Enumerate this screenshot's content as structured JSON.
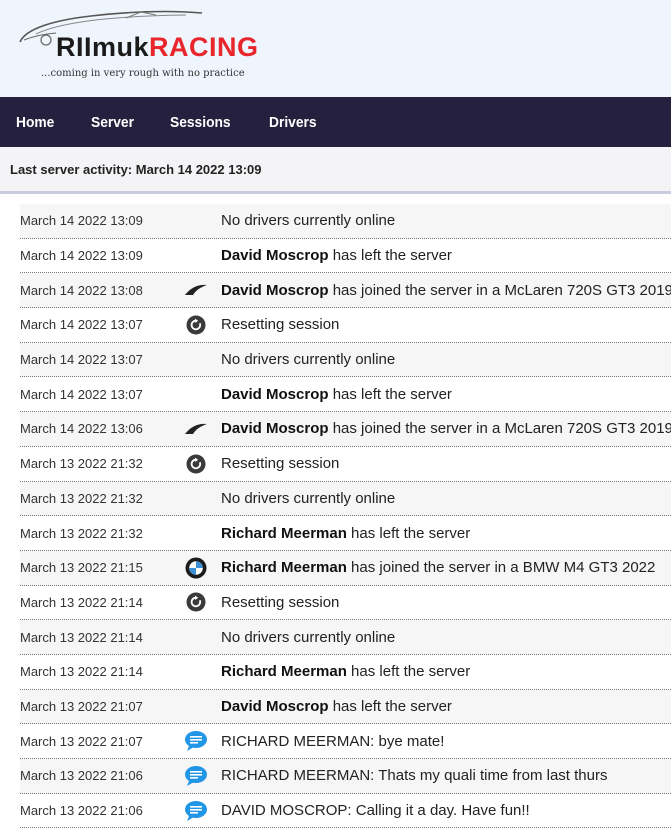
{
  "brand": {
    "part1": "RIImuk",
    "part2": "RACING",
    "tagline": "...coming in very rough with no practice"
  },
  "nav": [
    "Home",
    "Server",
    "Sessions",
    "Drivers"
  ],
  "activity": "Last server activity: March 14 2022 13:09",
  "colors": {
    "nav_bg": "#25203d",
    "accent": "#e8262b",
    "header_bg": "#eef5fc"
  },
  "log": [
    {
      "time": "March 14 2022 13:09",
      "icon": "",
      "name": "",
      "text": "No drivers currently online"
    },
    {
      "time": "March 14 2022 13:09",
      "icon": "",
      "name": "David Moscrop",
      "text": " has left the server"
    },
    {
      "time": "March 14 2022 13:08",
      "icon": "mclaren-logo-icon",
      "name": "David Moscrop",
      "text": " has joined the server in a McLaren 720S GT3 2019"
    },
    {
      "time": "March 14 2022 13:07",
      "icon": "reset-icon",
      "name": "",
      "text": "Resetting session"
    },
    {
      "time": "March 14 2022 13:07",
      "icon": "",
      "name": "",
      "text": "No drivers currently online"
    },
    {
      "time": "March 14 2022 13:07",
      "icon": "",
      "name": "David Moscrop",
      "text": " has left the server"
    },
    {
      "time": "March 14 2022 13:06",
      "icon": "mclaren-logo-icon",
      "name": "David Moscrop",
      "text": " has joined the server in a McLaren 720S GT3 2019"
    },
    {
      "time": "March 13 2022 21:32",
      "icon": "reset-icon",
      "name": "",
      "text": "Resetting session"
    },
    {
      "time": "March 13 2022 21:32",
      "icon": "",
      "name": "",
      "text": "No drivers currently online"
    },
    {
      "time": "March 13 2022 21:32",
      "icon": "",
      "name": "Richard Meerman",
      "text": " has left the server"
    },
    {
      "time": "March 13 2022 21:15",
      "icon": "bmw-logo-icon",
      "name": "Richard Meerman",
      "text": " has joined the server in a BMW M4 GT3 2022"
    },
    {
      "time": "March 13 2022 21:14",
      "icon": "reset-icon",
      "name": "",
      "text": "Resetting session"
    },
    {
      "time": "March 13 2022 21:14",
      "icon": "",
      "name": "",
      "text": "No drivers currently online"
    },
    {
      "time": "March 13 2022 21:14",
      "icon": "",
      "name": "Richard Meerman",
      "text": " has left the server"
    },
    {
      "time": "March 13 2022 21:07",
      "icon": "",
      "name": "David Moscrop",
      "text": " has left the server"
    },
    {
      "time": "March 13 2022 21:07",
      "icon": "chat-icon",
      "name": "",
      "text": "RICHARD MEERMAN: bye mate!"
    },
    {
      "time": "March 13 2022 21:06",
      "icon": "chat-icon",
      "name": "",
      "text": "RICHARD MEERMAN: Thats my quali time from last thurs"
    },
    {
      "time": "March 13 2022 21:06",
      "icon": "chat-icon",
      "name": "",
      "text": "DAVID MOSCROP: Calling it a day. Have fun!!"
    }
  ]
}
